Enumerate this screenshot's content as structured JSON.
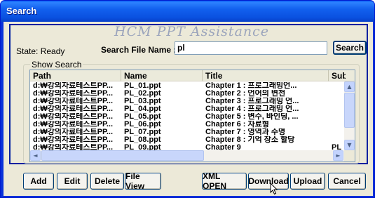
{
  "window": {
    "title": "Search"
  },
  "logo": {
    "text": "HCM PPT Assistance"
  },
  "search": {
    "state_label": "State: Ready",
    "file_name_label": "Search File Name :",
    "file_name_value": "pl",
    "search_button": "Search"
  },
  "results": {
    "group_label": "Show Search",
    "columns": [
      "Path",
      "Name",
      "Title",
      "Subje"
    ],
    "rows": [
      {
        "path": "d:₩강의자료테스트PP...",
        "name": "PL_01.ppt",
        "title": "Chapter 1 : 프로그래밍언...",
        "subject": ""
      },
      {
        "path": "d:₩강의자료테스트PP...",
        "name": "PL_02.ppt",
        "title": "Chapter 2 : 언어의 변천",
        "subject": ""
      },
      {
        "path": "d:₩강의자료테스트PP...",
        "name": "PL_03.ppt",
        "title": "Chapter 3 : 프로그래밍 언...",
        "subject": ""
      },
      {
        "path": "d:₩강의자료테스트PP...",
        "name": "PL_04.ppt",
        "title": "Chapter 4 : 프로그래밍 언...",
        "subject": ""
      },
      {
        "path": "d:₩강의자료테스트PP...",
        "name": "PL_05.ppt",
        "title": "Chapter 5 : 변수, 바인딩, ...",
        "subject": ""
      },
      {
        "path": "d:₩강의자료테스트PP...",
        "name": "PL_06.ppt",
        "title": "Chapter 6 : 자료형",
        "subject": ""
      },
      {
        "path": "d:₩강의자료테스트PP...",
        "name": "PL_07.ppt",
        "title": "Chapter 7 : 영역과 수명",
        "subject": ""
      },
      {
        "path": "d:₩강의자료테스트PP...",
        "name": "PL_08.ppt",
        "title": "Chapter 8 : 기억 장소 할당",
        "subject": ""
      },
      {
        "path": "d:₩강의자료테스트PP...",
        "name": "PL_09.ppt",
        "title": "Chapter 9",
        "subject": "PL"
      }
    ]
  },
  "buttons": {
    "add": "Add",
    "edit": "Edit",
    "delete": "Delete",
    "file_view": "File View",
    "xml_open": "XML OPEN",
    "download": "Download",
    "upload": "Upload",
    "cancel": "Cancel"
  },
  "icons": {
    "scroll_up": "▲",
    "scroll_down": "▼",
    "scroll_left": "◄",
    "scroll_right": "►"
  },
  "colors": {
    "title_bar": "#0a51e0",
    "panel_border": "#0020a0",
    "face": "#ece9d8"
  }
}
